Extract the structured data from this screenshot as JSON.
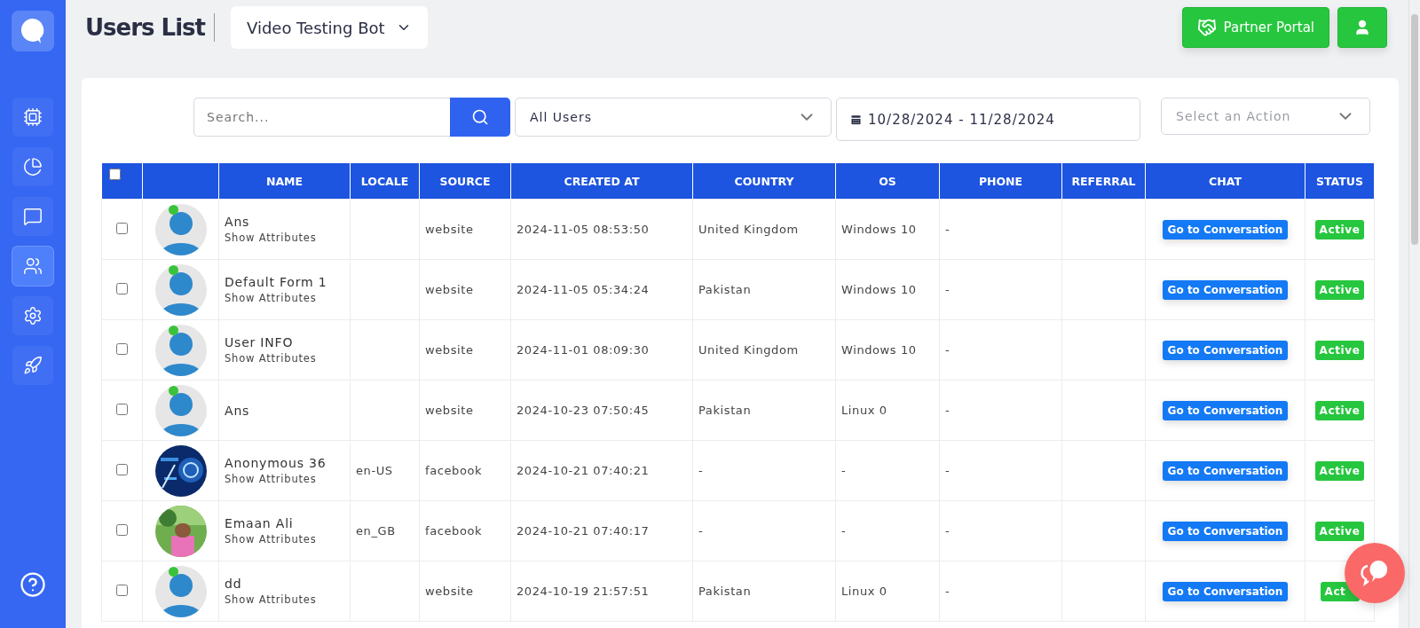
{
  "header": {
    "title": "Users List",
    "bot_selector": "Video Testing Bot",
    "partner_button": "Partner Portal"
  },
  "sidebar": {
    "items": [
      {
        "selected": false
      },
      {
        "selected": false
      },
      {
        "selected": false
      },
      {
        "selected": true
      },
      {
        "selected": false
      },
      {
        "selected": false
      }
    ]
  },
  "filters": {
    "search": {
      "placeholder": "Search..."
    },
    "user_filter": "All Users",
    "date_range": "10/28/2024 - 11/28/2024",
    "action": {
      "placeholder": "Select an Action"
    }
  },
  "table": {
    "select_all": {
      "checked": false
    },
    "columns": [
      "",
      "NAME",
      "LOCALE",
      "SOURCE",
      "CREATED AT",
      "COUNTRY",
      "OS",
      "PHONE",
      "REFERRAL",
      "CHAT",
      "STATUS"
    ],
    "rows": [
      {
        "checked": false,
        "avatar": {
          "kind": "default",
          "online": true
        },
        "name": "Ans",
        "attributes_link": "Show Attributes",
        "locale": "",
        "source": "website",
        "created_at": "2024-11-05 08:53:50",
        "country": "United Kingdom",
        "os": "Windows 10",
        "phone": "-",
        "referral": "",
        "chat": "Go to Conversation",
        "status": "Active"
      },
      {
        "checked": false,
        "avatar": {
          "kind": "default",
          "online": true
        },
        "name": "Default Form 1",
        "attributes_link": "Show Attributes",
        "locale": "",
        "source": "website",
        "created_at": "2024-11-05 05:34:24",
        "country": "Pakistan",
        "os": "Windows 10",
        "phone": "-",
        "referral": "",
        "chat": "Go to Conversation",
        "status": "Active"
      },
      {
        "checked": false,
        "avatar": {
          "kind": "default",
          "online": true
        },
        "name": "User INFO",
        "attributes_link": "Show Attributes",
        "locale": "",
        "source": "website",
        "created_at": "2024-11-01 08:09:30",
        "country": "United Kingdom",
        "os": "Windows 10",
        "phone": "-",
        "referral": "",
        "chat": "Go to Conversation",
        "status": "Active"
      },
      {
        "checked": false,
        "avatar": {
          "kind": "default",
          "online": true
        },
        "name": "Ans",
        "locale": "",
        "source": "website",
        "created_at": "2024-10-23 07:50:45",
        "country": "Pakistan",
        "os": "Linux 0",
        "phone": "-",
        "referral": "",
        "chat": "Go to Conversation",
        "status": "Active"
      },
      {
        "checked": false,
        "name": "Anonymous 36",
        "attributes_link": "Show Attributes",
        "locale": "en-US",
        "source": "facebook",
        "created_at": "2024-10-21 07:40:21",
        "country": "-",
        "os": "-",
        "phone": "-",
        "referral": "",
        "chat": "Go to Conversation",
        "status": "Active"
      },
      {
        "checked": false,
        "name": "Emaan Ali",
        "attributes_link": "Show Attributes",
        "locale": "en_GB",
        "source": "facebook",
        "created_at": "2024-10-21 07:40:17",
        "country": "-",
        "os": "-",
        "phone": "-",
        "referral": "",
        "chat": "Go to Conversation",
        "status": "Active"
      },
      {
        "checked": false,
        "avatar": {
          "kind": "default",
          "online": true
        },
        "name": "dd",
        "attributes_link": "Show Attributes",
        "locale": "",
        "source": "website",
        "created_at": "2024-10-19 21:57:51",
        "country": "Pakistan",
        "os": "Linux 0",
        "phone": "-",
        "referral": "",
        "chat": "Go to Conversation",
        "status": "Act"
      }
    ]
  }
}
